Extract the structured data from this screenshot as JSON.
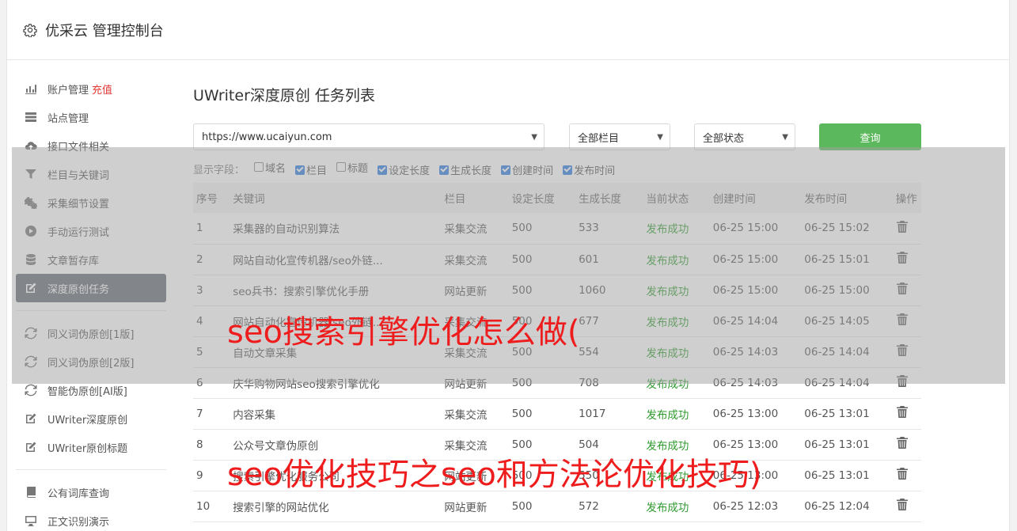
{
  "header": {
    "title": "优采云 管理控制台"
  },
  "sidebar": {
    "group1": [
      {
        "label": "账户管理",
        "badge": "充值",
        "icon": "bar-chart-icon"
      },
      {
        "label": "站点管理",
        "icon": "server-icon"
      },
      {
        "label": "接口文件相关",
        "icon": "cloud-upload-icon"
      },
      {
        "label": "栏目与关键词",
        "icon": "filter-icon"
      },
      {
        "label": "采集细节设置",
        "icon": "cogs-icon"
      },
      {
        "label": "手动运行测试",
        "icon": "play-circle-icon"
      },
      {
        "label": "文章暂存库",
        "icon": "database-icon"
      },
      {
        "label": "深度原创任务",
        "icon": "edit-icon",
        "active": true
      }
    ],
    "group2": [
      {
        "label": "同义词伪原创[1版]",
        "icon": "refresh-icon"
      },
      {
        "label": "同义词伪原创[2版]",
        "icon": "refresh-icon"
      },
      {
        "label": "智能伪原创[AI版]",
        "icon": "refresh-icon"
      },
      {
        "label": "UWriter深度原创",
        "icon": "edit-icon"
      },
      {
        "label": "UWriter原创标题",
        "icon": "edit-icon"
      }
    ],
    "group3": [
      {
        "label": "公有词库查询",
        "icon": "book-icon"
      },
      {
        "label": "正文识别演示",
        "icon": "monitor-icon"
      }
    ]
  },
  "main": {
    "title": "UWriter深度原创 任务列表",
    "filters": {
      "site": "https://www.ucaiyun.com",
      "column": "全部栏目",
      "status": "全部状态",
      "query_label": "查询"
    },
    "fields_label": "显示字段：",
    "fields": [
      {
        "label": "域名",
        "checked": false
      },
      {
        "label": "栏目",
        "checked": true
      },
      {
        "label": "标题",
        "checked": false
      },
      {
        "label": "设定长度",
        "checked": true
      },
      {
        "label": "生成长度",
        "checked": true
      },
      {
        "label": "创建时间",
        "checked": true
      },
      {
        "label": "发布时间",
        "checked": true
      }
    ],
    "table": {
      "headers": [
        "序号",
        "关键词",
        "栏目",
        "设定长度",
        "生成长度",
        "当前状态",
        "创建时间",
        "发布时间",
        "操作"
      ],
      "rows": [
        [
          "1",
          "采集器的自动识别算法",
          "采集交流",
          "500",
          "533",
          "发布成功",
          "06-25 15:00",
          "06-25 15:02"
        ],
        [
          "2",
          "网站自动化宣传机器/seo外链...",
          "采集交流",
          "500",
          "601",
          "发布成功",
          "06-25 15:00",
          "06-25 15:01"
        ],
        [
          "3",
          "seo兵书：搜索引擎优化手册",
          "网站更新",
          "500",
          "1060",
          "发布成功",
          "06-25 15:00",
          "06-25 15:00"
        ],
        [
          "4",
          "网站自动化宣传机器/seo外链...",
          "采集交流",
          "500",
          "677",
          "发布成功",
          "06-25 14:04",
          "06-25 14:05"
        ],
        [
          "5",
          "自动文章采集",
          "采集交流",
          "500",
          "554",
          "发布成功",
          "06-25 14:03",
          "06-25 14:04"
        ],
        [
          "6",
          "庆华购物网站seo搜索引擎优化",
          "网站更新",
          "500",
          "708",
          "发布成功",
          "06-25 14:03",
          "06-25 14:04"
        ],
        [
          "7",
          "内容采集",
          "采集交流",
          "500",
          "1017",
          "发布成功",
          "06-25 13:00",
          "06-25 13:01"
        ],
        [
          "8",
          "公众号文章伪原创",
          "采集交流",
          "500",
          "504",
          "发布成功",
          "06-25 13:00",
          "06-25 13:01"
        ],
        [
          "9",
          "搜索引擎优化服务公司",
          "网站更新",
          "500",
          "550",
          "发布成功",
          "06-25 13:00",
          "06-25 13:01"
        ],
        [
          "10",
          "搜索引擎的网站优化",
          "网站更新",
          "500",
          "572",
          "发布成功",
          "06-25 12:03",
          "06-25 12:04"
        ]
      ]
    }
  },
  "watermarks": {
    "line1": "seo搜索引擎优化怎么做(",
    "line2": "seo优化技巧之seo和方法论优化技巧)"
  },
  "colors": {
    "accent_green": "#5cb85c",
    "status_green": "#2e9a2e",
    "active_nav": "#656a73",
    "watermark_red": "#ee1c1c"
  }
}
